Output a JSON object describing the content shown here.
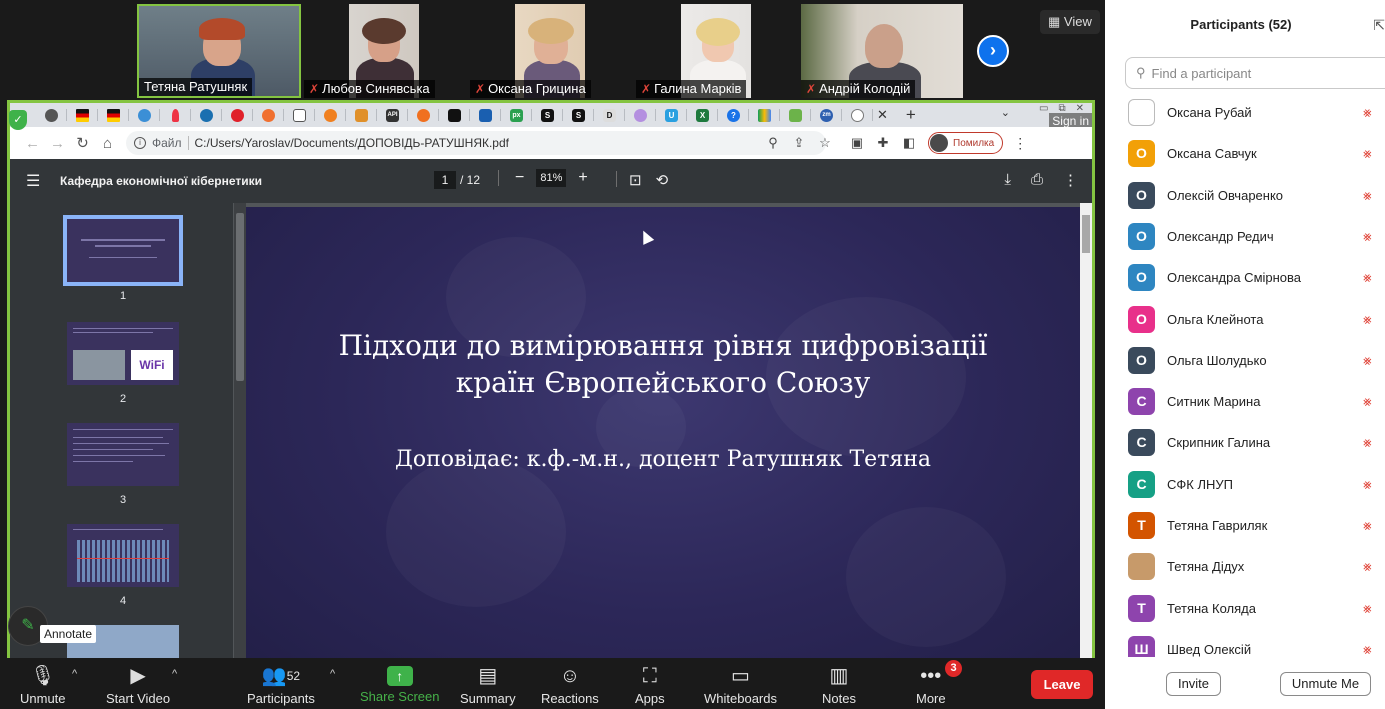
{
  "meeting": {
    "view_label": "View",
    "tiles": [
      {
        "name": "Тетяна Ратушняк",
        "muted": false
      },
      {
        "name": "Любов Синявська",
        "muted": true
      },
      {
        "name": "Оксана Грицина",
        "muted": true
      },
      {
        "name": "Галина Марків",
        "muted": true
      },
      {
        "name": "Андрій Колодій",
        "muted": true
      }
    ]
  },
  "browser": {
    "sign_in": "Sign in",
    "url_prefix": "Файл",
    "url": "C:/Users/Yaroslav/Documents/ДОПОВІДЬ-РАТУШНЯК.pdf",
    "profile_label": "Помилка"
  },
  "pdf": {
    "title": "Кафедра економічної кібернетики",
    "current_page": "1",
    "total_pages": "/ 12",
    "zoom": "81%",
    "thumbnails": [
      "1",
      "2",
      "3",
      "4"
    ]
  },
  "slide": {
    "title_line1": "Підходи до вимірювання рівня цифровізації",
    "title_line2": "країн Європейського Союзу",
    "subtitle": "Доповідає: к.ф.-м.н., доцент Ратушняк Тетяна"
  },
  "annotate_tooltip": "Annotate",
  "toolbar": {
    "unmute": "Unmute",
    "start_video": "Start Video",
    "participants": "Participants",
    "participants_count": "52",
    "share_screen": "Share Screen",
    "summary": "Summary",
    "reactions": "Reactions",
    "apps": "Apps",
    "whiteboards": "Whiteboards",
    "notes": "Notes",
    "more": "More",
    "more_badge": "3",
    "leave": "Leave"
  },
  "panel": {
    "title": "Participants (52)",
    "search_placeholder": "Find a participant",
    "participants": [
      {
        "name": "Оксана Рубай",
        "initial": "",
        "color": "#ffffff"
      },
      {
        "name": "Оксана Савчук",
        "initial": "О",
        "color": "#f2a007"
      },
      {
        "name": "Олексій Овчаренко",
        "initial": "О",
        "color": "#3a4a5c"
      },
      {
        "name": "Олександр Редич",
        "initial": "О",
        "color": "#2e86c1"
      },
      {
        "name": "Олександра Смірнова",
        "initial": "О",
        "color": "#2e86c1"
      },
      {
        "name": "Ольга Клейнота",
        "initial": "О",
        "color": "#e8308a"
      },
      {
        "name": "Ольга Шолудько",
        "initial": "О",
        "color": "#3a4a5c"
      },
      {
        "name": "Ситник Марина",
        "initial": "С",
        "color": "#8e44ad"
      },
      {
        "name": "Скрипник Галина",
        "initial": "С",
        "color": "#3a4a5c"
      },
      {
        "name": "СФК ЛНУП",
        "initial": "С",
        "color": "#16a085"
      },
      {
        "name": "Тетяна Гавриляк",
        "initial": "Т",
        "color": "#d35400"
      },
      {
        "name": "Тетяна Дідух",
        "initial": "",
        "color": "#c79a6a"
      },
      {
        "name": "Тетяна Коляда",
        "initial": "Т",
        "color": "#8e44ad"
      },
      {
        "name": "Швед Олексій",
        "initial": "Ш",
        "color": "#8e44ad"
      }
    ],
    "invite": "Invite",
    "unmute_me": "Unmute Me"
  }
}
